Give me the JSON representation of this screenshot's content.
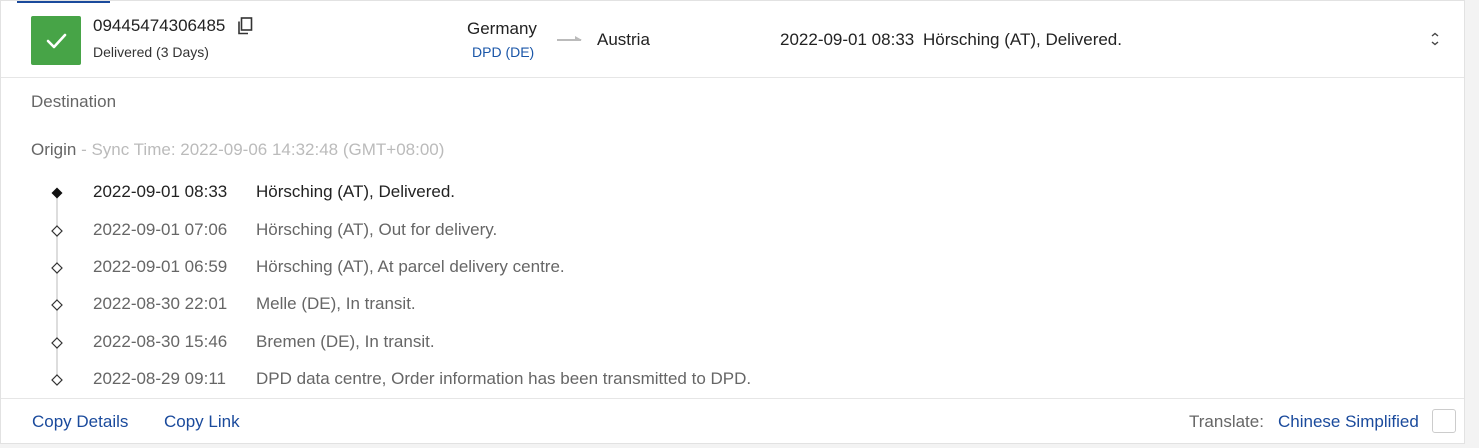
{
  "colors": {
    "status": "#47a447",
    "link": "#1a4a9c",
    "muted": "#666666"
  },
  "shipment": {
    "tracking_number": "09445474306485",
    "status_text": "Delivered (3 Days)",
    "status_icon": "check-icon",
    "origin_country": "Germany",
    "carrier": "DPD (DE)",
    "destination_country": "Austria",
    "latest_time": "2022-09-01 08:33",
    "latest_desc": "Hörsching (AT), Delivered."
  },
  "details": {
    "destination_label": "Destination",
    "origin_label": "Origin",
    "sync_text": " - Sync Time: 2022-09-06 14:32:48 (GMT+08:00)"
  },
  "events": [
    {
      "time": "2022-09-01 08:33",
      "desc": "Hörsching (AT), Delivered."
    },
    {
      "time": "2022-09-01 07:06",
      "desc": "Hörsching (AT), Out for delivery."
    },
    {
      "time": "2022-09-01 06:59",
      "desc": "Hörsching (AT), At parcel delivery centre."
    },
    {
      "time": "2022-08-30 22:01",
      "desc": "Melle (DE), In transit."
    },
    {
      "time": "2022-08-30 15:46",
      "desc": "Bremen (DE), In transit."
    },
    {
      "time": "2022-08-29 09:11",
      "desc": "DPD data centre, Order information has been transmitted to DPD."
    }
  ],
  "footer": {
    "copy_details": "Copy Details",
    "copy_link": "Copy Link",
    "translate_label": "Translate:",
    "translate_language": "Chinese Simplified"
  }
}
